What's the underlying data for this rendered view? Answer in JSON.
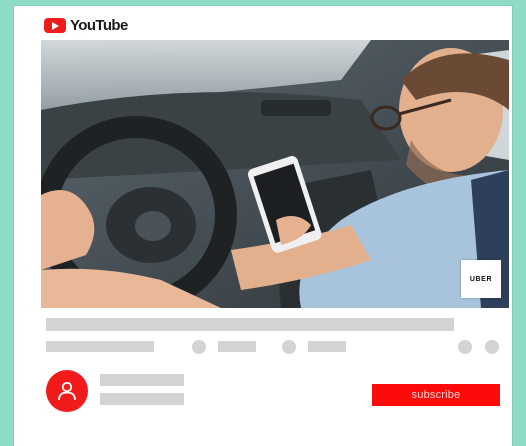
{
  "brand": {
    "wordmark": "YouTube",
    "logo_icon": "youtube-play-icon",
    "red": "#ee1c1c"
  },
  "video": {
    "badge_text": "UBER",
    "scene": "driver-holding-phone"
  },
  "channel": {
    "avatar_icon": "user-icon",
    "subscribe_label": "subscribe",
    "subscribe_color": "#ff0a0a"
  },
  "colors": {
    "background": "#8fdcc6",
    "placeholder": "#d3d3d3"
  }
}
